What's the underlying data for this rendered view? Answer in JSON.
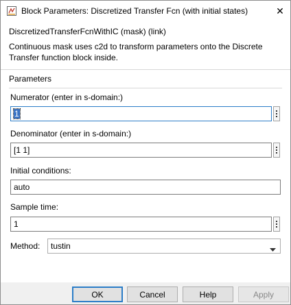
{
  "window": {
    "title": "Block Parameters: Discretized Transfer Fcn (with initial states)",
    "close_glyph": "✕",
    "app_icon": "block-parameters-icon"
  },
  "mask": {
    "header": "DiscretizedTransferFcnWithIC (mask) (link)",
    "description": "Continuous mask uses c2d to transform parameters onto the Discrete Transfer function block inside."
  },
  "parameters": {
    "title": "Parameters",
    "numerator": {
      "label": "Numerator (enter in s-domain:)",
      "value": "1"
    },
    "denominator": {
      "label": "Denominator (enter in s-domain:)",
      "value": "[1 1]"
    },
    "initial_conditions": {
      "label": "Initial conditions:",
      "value": "auto"
    },
    "sample_time": {
      "label": "Sample time:",
      "value": "1"
    },
    "method": {
      "label": "Method:",
      "value": "tustin"
    }
  },
  "buttons": {
    "ok": "OK",
    "cancel": "Cancel",
    "help": "Help",
    "apply": "Apply"
  },
  "colors": {
    "focus": "#2a7cc7",
    "selection": "#3a74c5",
    "dialog_bg": "#f0f0f0",
    "panel_bg": "#ffffff"
  }
}
